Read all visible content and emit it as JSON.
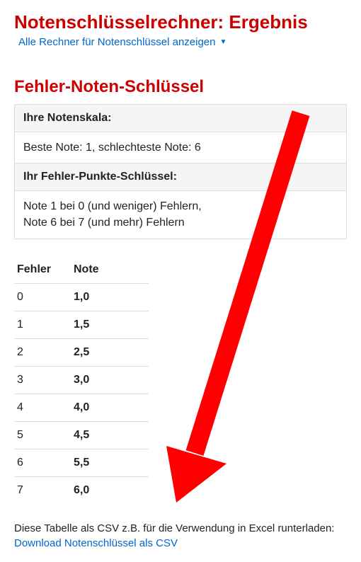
{
  "header": {
    "page_title": "Notenschlüsselrechner: Ergebnis",
    "all_link_label": "Alle Rechner für Notenschlüssel anzeigen"
  },
  "section": {
    "title": "Fehler-Noten-Schlüssel",
    "scale_heading": "Ihre Notenskala:",
    "scale_body": "Beste Note: 1, schlechteste Note: 6",
    "key_heading": "Ihr Fehler-Punkte-Schlüssel:",
    "key_body_line1": "Note 1 bei 0 (und weniger) Fehlern,",
    "key_body_line2": "Note 6 bei 7 (und mehr) Fehlern"
  },
  "table": {
    "col_fehler": "Fehler",
    "col_note": "Note",
    "rows": [
      {
        "fehler": "0",
        "note": "1,0"
      },
      {
        "fehler": "1",
        "note": "1,5"
      },
      {
        "fehler": "2",
        "note": "2,5"
      },
      {
        "fehler": "3",
        "note": "3,0"
      },
      {
        "fehler": "4",
        "note": "4,0"
      },
      {
        "fehler": "5",
        "note": "4,5"
      },
      {
        "fehler": "6",
        "note": "5,5"
      },
      {
        "fehler": "7",
        "note": "6,0"
      }
    ]
  },
  "download": {
    "intro": "Diese Tabelle als CSV z.B. für die Verwendung in Excel runterladen:",
    "link_label": "Download Notenschlüssel als CSV"
  }
}
